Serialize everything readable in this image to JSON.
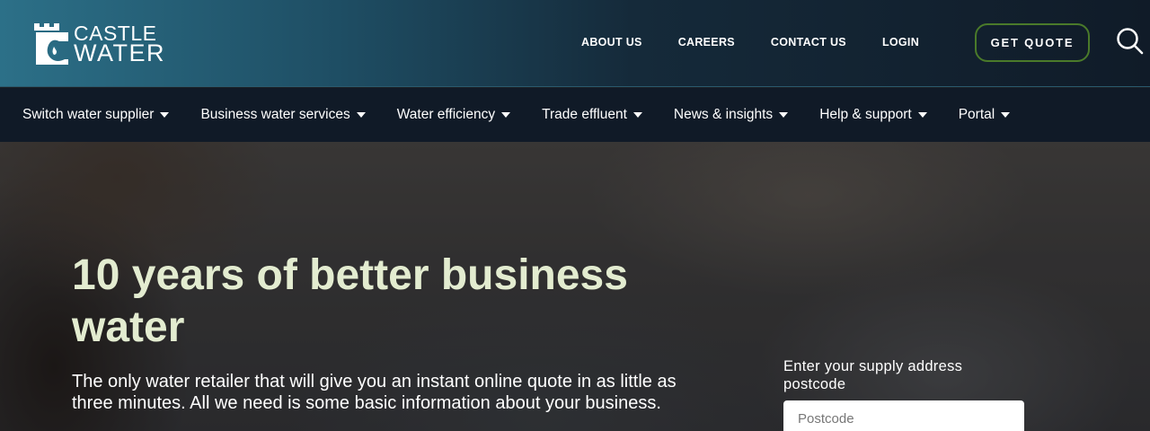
{
  "brand": {
    "logo_line1": "CASTLE",
    "logo_line2": "WATER"
  },
  "top_links": {
    "about": "ABOUT US",
    "careers": "CAREERS",
    "contact": "CONTACT US",
    "login": "LOGIN"
  },
  "quote_button": "GET QUOTE",
  "search_icon": "search-icon",
  "main_nav": [
    {
      "label": "Switch water supplier"
    },
    {
      "label": "Business water services"
    },
    {
      "label": "Water efficiency"
    },
    {
      "label": "Trade effluent"
    },
    {
      "label": "News & insights"
    },
    {
      "label": "Help & support"
    },
    {
      "label": "Portal"
    }
  ],
  "hero": {
    "title": "10 years of better business water",
    "subtitle": "The only water retailer that will give you an instant online quote in as little as three minutes. All we need is some basic information about your business.",
    "postcode_label": "Enter your supply address postcode",
    "postcode_placeholder": "Postcode",
    "postcode_value": ""
  },
  "colors": {
    "header_gradient_start": "#2c7088",
    "nav_background": "#101a27",
    "quote_border": "#4a7a2a",
    "hero_title": "#e3ecd0"
  }
}
